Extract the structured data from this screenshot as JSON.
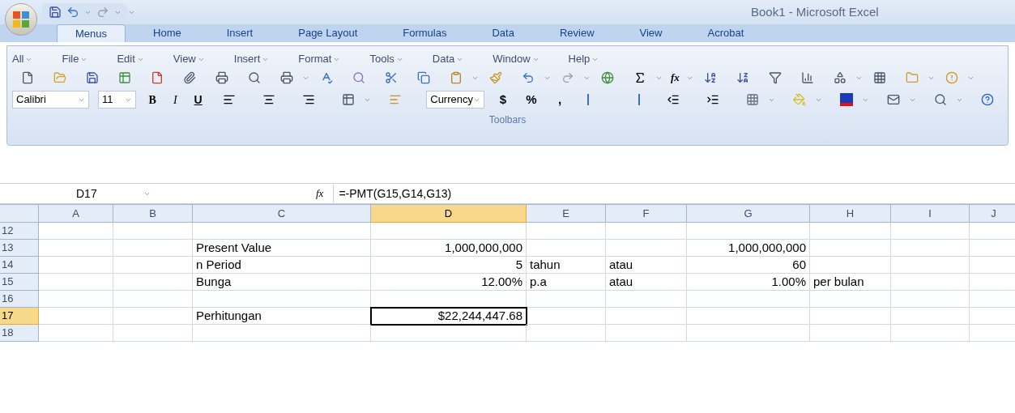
{
  "window": {
    "title": "Book1 - Microsoft Excel"
  },
  "tabs": [
    {
      "label": "Menus",
      "selected": true
    },
    {
      "label": "Home",
      "selected": false
    },
    {
      "label": "Insert",
      "selected": false
    },
    {
      "label": "Page Layout",
      "selected": false
    },
    {
      "label": "Formulas",
      "selected": false
    },
    {
      "label": "Data",
      "selected": false
    },
    {
      "label": "Review",
      "selected": false
    },
    {
      "label": "View",
      "selected": false
    },
    {
      "label": "Acrobat",
      "selected": false
    }
  ],
  "menus": [
    "All",
    "File",
    "Edit",
    "View",
    "Insert",
    "Format",
    "Tools",
    "Data",
    "Window",
    "Help"
  ],
  "standard_toolbar": {
    "function_label": "fx"
  },
  "format_toolbar": {
    "font": "Calibri",
    "size": "11",
    "number_format": "Currency",
    "buttons": [
      {
        "kind": "bold",
        "label": "B"
      },
      {
        "kind": "italic",
        "label": "I"
      },
      {
        "kind": "underline",
        "label": "U"
      }
    ],
    "number_buttons": [
      "$",
      "%",
      ","
    ]
  },
  "group_label": "Toolbars",
  "formula_bar": {
    "name_box": "D17",
    "fx": "fx",
    "formula": "=-PMT(G15,G14,G13)"
  },
  "sheet": {
    "columns": [
      {
        "label": "A",
        "selected": false
      },
      {
        "label": "B",
        "selected": false
      },
      {
        "label": "C",
        "selected": false
      },
      {
        "label": "D",
        "selected": true
      },
      {
        "label": "E",
        "selected": false
      },
      {
        "label": "F",
        "selected": false
      },
      {
        "label": "G",
        "selected": false
      },
      {
        "label": "H",
        "selected": false
      },
      {
        "label": "I",
        "selected": false
      },
      {
        "label": "J",
        "selected": false
      }
    ],
    "rows": [
      {
        "number": "12",
        "selected": false,
        "cells": [
          "",
          "",
          "",
          "",
          "",
          "",
          "",
          "",
          "",
          ""
        ]
      },
      {
        "number": "13",
        "selected": false,
        "cells": [
          "",
          "",
          "Present Value",
          "1,000,000,000",
          "",
          "",
          "1,000,000,000",
          "",
          "",
          ""
        ]
      },
      {
        "number": "14",
        "selected": false,
        "cells": [
          "",
          "",
          "n Period",
          "5",
          "tahun",
          "atau",
          "60",
          "",
          "",
          ""
        ]
      },
      {
        "number": "15",
        "selected": false,
        "cells": [
          "",
          "",
          "Bunga",
          "12.00%",
          "p.a",
          "atau",
          "1.00%",
          "per bulan",
          "",
          ""
        ]
      },
      {
        "number": "16",
        "selected": false,
        "cells": [
          "",
          "",
          "",
          "",
          "",
          "",
          "",
          "",
          "",
          ""
        ]
      },
      {
        "number": "17",
        "selected": true,
        "cells": [
          "",
          "",
          "Perhitungan",
          "$22,244,447.68",
          "",
          "",
          "",
          "",
          "",
          ""
        ]
      },
      {
        "number": "18",
        "selected": false,
        "cells": [
          "",
          "",
          "",
          "",
          "",
          "",
          "",
          "",
          "",
          ""
        ]
      }
    ]
  }
}
